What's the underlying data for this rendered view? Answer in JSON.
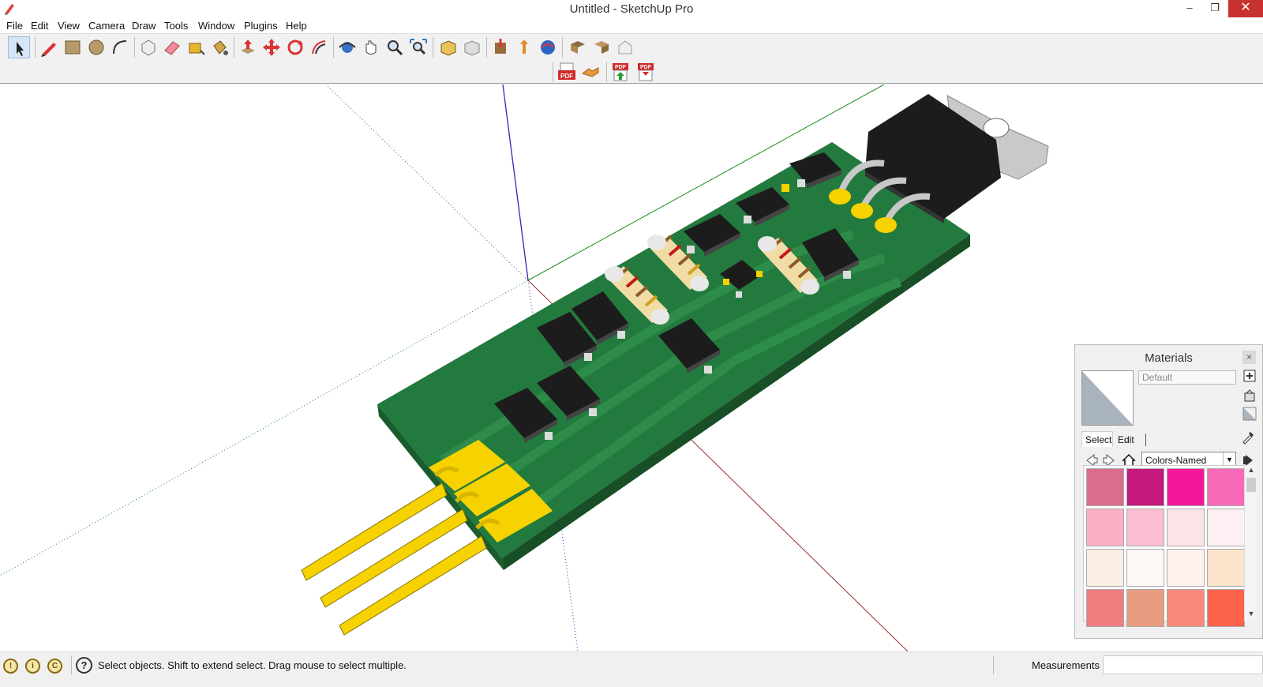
{
  "window": {
    "title": "Untitled - SketchUp Pro",
    "minimize": "–",
    "maximize": "❐",
    "close": "✕"
  },
  "menu": [
    "File",
    "Edit",
    "View",
    "Camera",
    "Draw",
    "Tools",
    "Window",
    "Plugins",
    "Help"
  ],
  "toolbar": {
    "tools": [
      "select-tool-icon",
      "pencil-line-icon",
      "rectangle-icon",
      "circle-icon",
      "arc-icon",
      "make-component-icon",
      "eraser-icon",
      "tape-measure-icon",
      "paint-bucket-icon",
      "push-pull-icon",
      "move-icon",
      "rotate-icon",
      "offset-icon",
      "orbit-icon",
      "pan-icon",
      "zoom-icon",
      "zoom-extents-icon",
      "previous-view-icon",
      "next-view-icon",
      "get-models-icon",
      "share-model-icon",
      "share-component-icon",
      "add-location-icon",
      "toggle-terrain-icon",
      "extension-warehouse-icon"
    ],
    "plugins": [
      "export-pdf-icon",
      "handshake-icon",
      "pdf-import-icon",
      "pdf-html-icon"
    ]
  },
  "materials": {
    "title": "Materials",
    "close": "×",
    "name_placeholder": "Default",
    "tabs": {
      "select": "Select",
      "edit": "Edit"
    },
    "library": "Colors-Named",
    "swatches": [
      "#db6d8c",
      "#c5187d",
      "#f4179a",
      "#f86ab7",
      "#f9b0c3",
      "#fbbdd0",
      "#fce3e5",
      "#fdf0f3",
      "#faeee4",
      "#fdf8f6",
      "#fdf2ee",
      "#fce3cc",
      "#ee7d80",
      "#e99c80",
      "#f8897b",
      "#fd624b"
    ]
  },
  "status": {
    "message": "Select objects. Shift to extend select. Drag mouse to select multiple.",
    "measurements_label": "Measurements",
    "icons": [
      "geo-location-icon",
      "credits-icon",
      "copyright-icon"
    ]
  }
}
